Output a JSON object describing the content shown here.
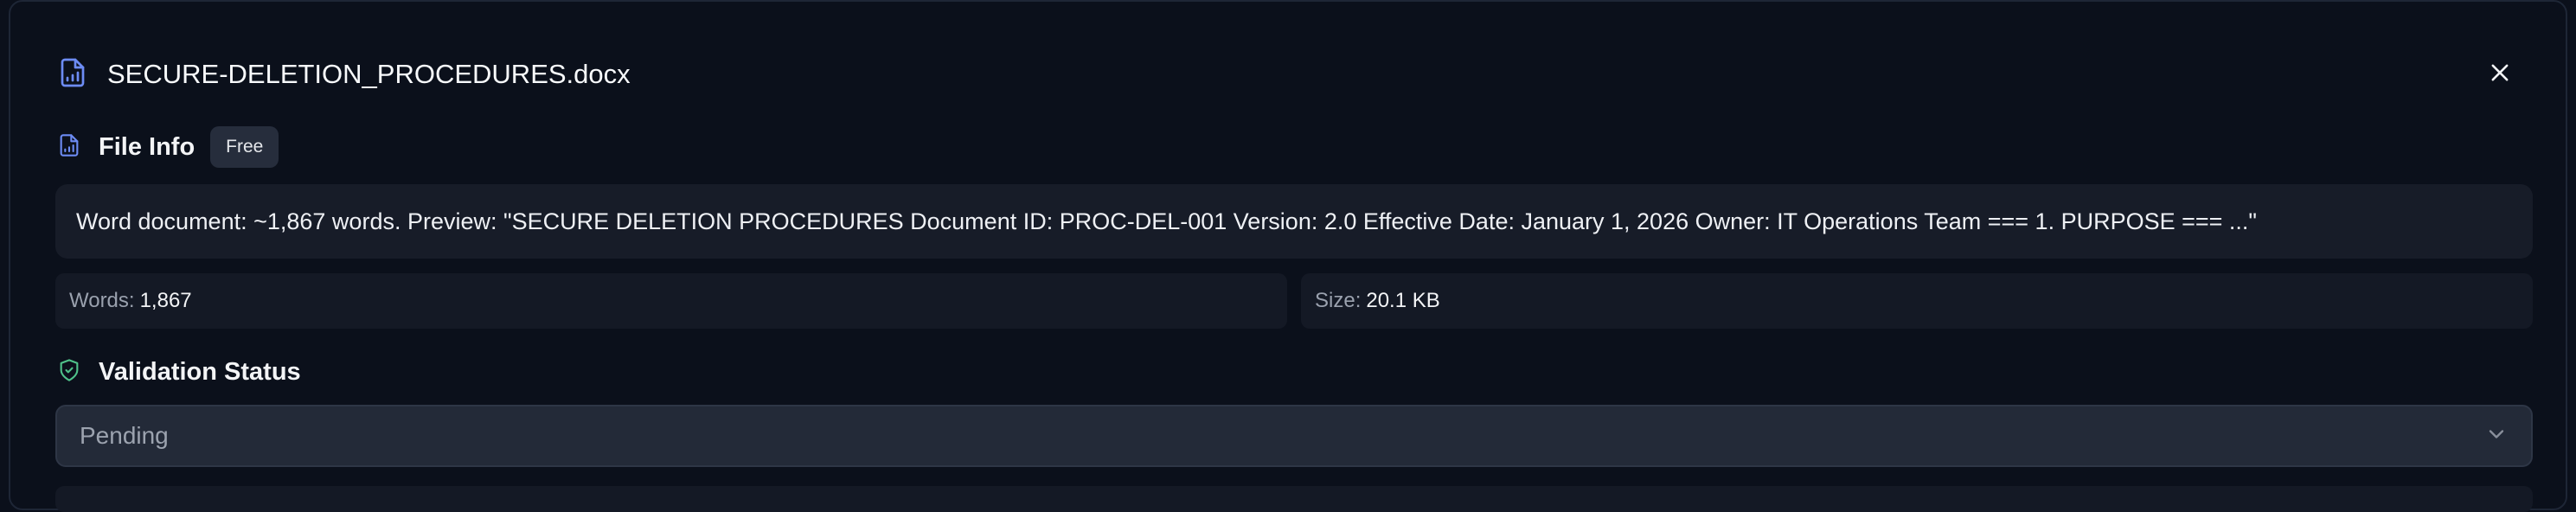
{
  "dialog": {
    "title": "SECURE-DELETION_PROCEDURES.docx",
    "title_icon": "file-chart-icon",
    "close_icon": "close-icon"
  },
  "file_info": {
    "heading": "File Info",
    "icon": "file-chart-icon",
    "badge": "Free",
    "preview": "Word document: ~1,867 words. Preview: \"SECURE DELETION PROCEDURES Document ID: PROC-DEL-001 Version: 2.0 Effective Date: January 1, 2026 Owner: IT Operations Team === 1. PURPOSE === ...\"",
    "words_label": "Words:",
    "words_value": "1,867",
    "size_label": "Size:",
    "size_value": "20.1 KB"
  },
  "validation": {
    "heading": "Validation Status",
    "icon": "shield-icon",
    "selected": "Pending",
    "dropdown_icon": "chevron-down-icon"
  },
  "colors": {
    "accent": "#6d8cf5",
    "validation_icon": "#4fc28a",
    "background": "#0b101b"
  }
}
